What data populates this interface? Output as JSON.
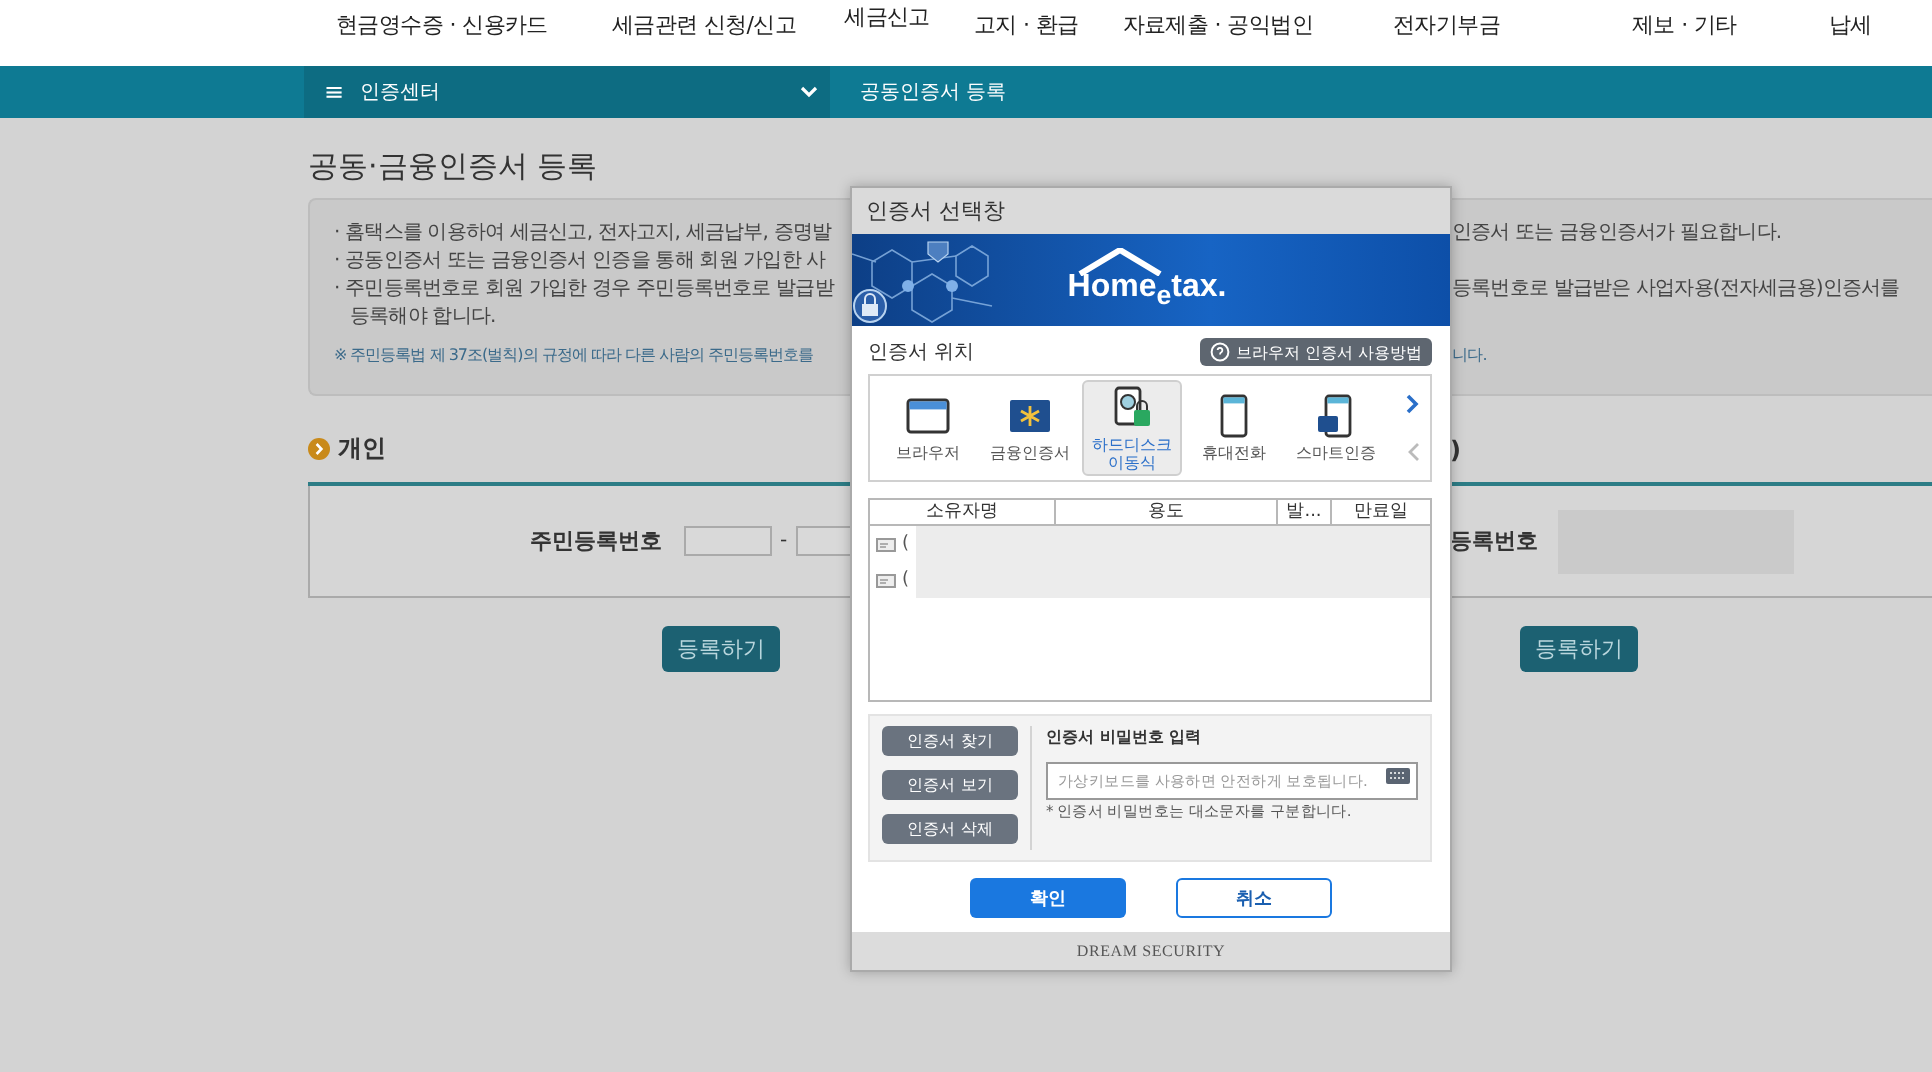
{
  "top_nav": {
    "items": [
      "현금영수증 · 신용카드",
      "세금관련 신청/신고",
      "세금신고",
      "고지 · 환급",
      "자료제출 · 공익법인",
      "전자기부금",
      "제보 · 기타",
      "납세"
    ]
  },
  "breadcrumb": {
    "menu_icon": "≡",
    "menu_label": "인증센터",
    "current": "공동인증서 등록"
  },
  "page": {
    "title": "공동·금융인증서 등록",
    "notice_lines": [
      {
        "kind": "bullet",
        "left": "· 홈택스를 이용하여 세금신고, 전자고지, 세금납부, 증명발",
        "right": "인증서 또는 금융인증서가 필요합니다."
      },
      {
        "kind": "bullet",
        "left": "· 공동인증서 또는 금융인증서 인증을 통해 회원 가입한 사"
      },
      {
        "kind": "bullet",
        "left": "· 주민등록번호로 회원 가입한 경우 주민등록번호로 발급받",
        "right": "등록번호로 발급받은 사업자용(전자세금용)인증서를"
      },
      {
        "kind": "continuation",
        "left": "등록해야 합니다."
      },
      {
        "kind": "note",
        "left": "※ 주민등록법 제 37조(벌칙)의 규정에 따라 다른 사람의 주민등록번호를",
        "right": "니다."
      }
    ],
    "sections": [
      {
        "kind": "inputs",
        "heading": "개인",
        "field_label": "주민등록번호",
        "separator": "-",
        "button": "등록하기"
      },
      {
        "kind": "redacted",
        "heading": ")",
        "field_label": "등록번호",
        "button": "등록하기"
      }
    ]
  },
  "dialog": {
    "title": "인증서 선택창",
    "logo_text": "Home$_{e}$tax.",
    "location_label": "인증서 위치",
    "help_button": "브라우저 인증서 사용방법",
    "locations": [
      {
        "kind": "browser",
        "label": "브라우저",
        "selected": false
      },
      {
        "kind": "financial",
        "label": "금융인증서",
        "selected": false
      },
      {
        "kind": "disk",
        "label": "하드디스크 이동식",
        "selected": true
      },
      {
        "kind": "phone",
        "label": "휴대전화",
        "selected": false
      },
      {
        "kind": "smart",
        "label": "스마트인증",
        "selected": false
      }
    ],
    "table": {
      "columns": [
        "소유자명",
        "용도",
        "발...",
        "만료일"
      ],
      "rows": [
        {
          "owner": "("
        },
        {
          "owner": "("
        }
      ]
    },
    "side_buttons": [
      "인증서 찾기",
      "인증서 보기",
      "인증서 삭제"
    ],
    "password": {
      "label": "인증서 비밀번호 입력",
      "placeholder": "가상키보드를 사용하면 안전하게 보호됩니다.",
      "note": "* 인증서 비밀번호는 대소문자를 구분합니다."
    },
    "buttons": [
      {
        "kind": "primary",
        "label": "확인"
      },
      {
        "kind": "secondary",
        "label": "취소"
      }
    ],
    "footer": "DREAM SECURITY"
  }
}
